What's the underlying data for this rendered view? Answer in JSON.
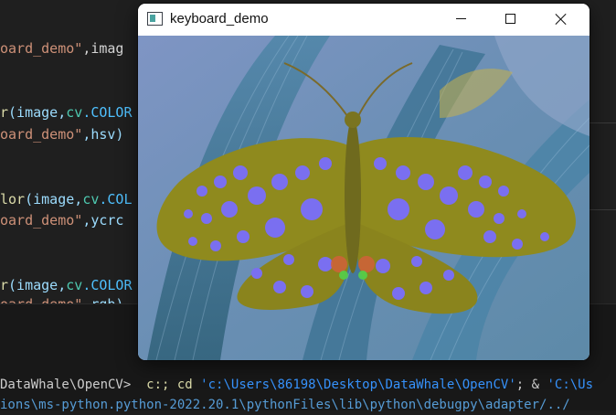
{
  "editor": {
    "lines": [
      {
        "parts": [
          {
            "t": "oard_demo\"",
            "c": "str"
          },
          {
            "t": ",imag",
            "c": "plain"
          }
        ]
      },
      {
        "parts": [
          {
            "t": "r",
            "c": "fn"
          },
          {
            "t": "(image,",
            "c": "var"
          },
          {
            "t": "cv",
            "c": "mod"
          },
          {
            "t": ".COLOR",
            "c": "const"
          }
        ]
      },
      {
        "parts": [
          {
            "t": "oard_demo\"",
            "c": "str"
          },
          {
            "t": ",hsv)",
            "c": "var"
          }
        ]
      },
      {
        "parts": [
          {
            "t": "lor",
            "c": "fn"
          },
          {
            "t": "(image,",
            "c": "var"
          },
          {
            "t": "cv",
            "c": "mod"
          },
          {
            "t": ".COL",
            "c": "const"
          }
        ]
      },
      {
        "parts": [
          {
            "t": "oard_demo\"",
            "c": "str"
          },
          {
            "t": ",ycrc",
            "c": "var"
          }
        ]
      },
      {
        "parts": [
          {
            "t": "r",
            "c": "fn"
          },
          {
            "t": "(image,",
            "c": "var"
          },
          {
            "t": "cv",
            "c": "mod"
          },
          {
            "t": ".COLOR",
            "c": "const"
          }
        ]
      },
      {
        "parts": [
          {
            "t": "oard_demo\"",
            "c": "str"
          },
          {
            "t": ",rgb)",
            "c": "var"
          }
        ]
      }
    ]
  },
  "terminal": {
    "line1": {
      "path": "DataWhale\\OpenCV>",
      "cmd1": "c:; ",
      "cmd2": "cd ",
      "str1": "'c:\\Users\\86198\\Desktop\\DataWhale\\OpenCV'",
      "sep": "; & ",
      "str2": "'C:\\Us"
    },
    "line2": "ions\\ms-python.python-2022.20.1\\pythonFiles\\lib\\python\\debugpy\\adapter/../"
  },
  "window": {
    "title": "keyboard_demo",
    "image_colors": {
      "background_blue": "#6f8fb8",
      "leaf_teal": "#3f6f86",
      "wing_olive": "#8f8a1e",
      "spot_violet": "#7a6ff0",
      "highlight_yellow": "#c9b24a"
    }
  }
}
